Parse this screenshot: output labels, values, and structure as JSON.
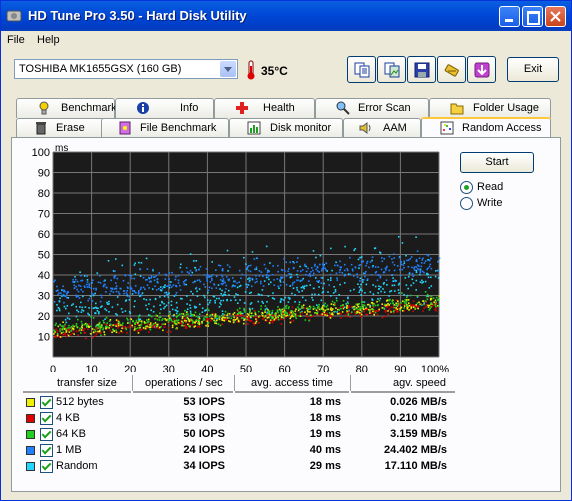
{
  "window": {
    "title": "HD Tune Pro 3.50 - Hard Disk Utility"
  },
  "menu": {
    "file": "File",
    "help": "Help"
  },
  "toolbar": {
    "drive": "TOSHIBA MK1655GSX (160 GB)",
    "temperature": "35°C",
    "exit_label": "Exit",
    "icons": [
      "copy-text-icon",
      "copy-image-icon",
      "save-icon",
      "options-icon",
      "download-icon"
    ]
  },
  "tabs_top": [
    {
      "label": "Benchmark",
      "icon": "benchmark-icon"
    },
    {
      "label": "Info",
      "icon": "info-icon"
    },
    {
      "label": "Health",
      "icon": "health-icon"
    },
    {
      "label": "Error Scan",
      "icon": "error-scan-icon"
    },
    {
      "label": "Folder Usage",
      "icon": "folder-icon"
    }
  ],
  "tabs_bottom": [
    {
      "label": "Erase",
      "icon": "erase-icon"
    },
    {
      "label": "File Benchmark",
      "icon": "file-benchmark-icon"
    },
    {
      "label": "Disk monitor",
      "icon": "disk-monitor-icon"
    },
    {
      "label": "AAM",
      "icon": "speaker-icon"
    },
    {
      "label": "Random Access",
      "icon": "random-access-icon",
      "active": true
    }
  ],
  "controls": {
    "start_label": "Start",
    "read_label": "Read",
    "write_label": "Write",
    "selected": "Read"
  },
  "chart_data": {
    "type": "scatter",
    "ylabel": "ms",
    "ylim": [
      0,
      100
    ],
    "xlim": [
      0,
      100
    ],
    "y_ticks": [
      "100",
      "90",
      "80",
      "70",
      "60",
      "50",
      "40",
      "30",
      "20",
      "10"
    ],
    "x_ticks": [
      "0",
      "10",
      "20",
      "30",
      "40",
      "50",
      "60",
      "70",
      "80",
      "90",
      "100%"
    ],
    "grid": true,
    "background": "#1b1b1b",
    "series": [
      {
        "name": "512 bytes",
        "color": "#f0f000",
        "trend_start_ms": 13,
        "trend_end_ms": 27,
        "spread_ms": 5
      },
      {
        "name": "4 KB",
        "color": "#e00000",
        "trend_start_ms": 12,
        "trend_end_ms": 26,
        "spread_ms": 5
      },
      {
        "name": "64 KB",
        "color": "#20d020",
        "trend_start_ms": 14,
        "trend_end_ms": 28,
        "spread_ms": 6
      },
      {
        "name": "1 MB",
        "color": "#2080ff",
        "trend_start_ms": 33,
        "trend_end_ms": 46,
        "spread_ms": 10
      },
      {
        "name": "Random",
        "color": "#20d8ff",
        "trend_start_ms": 22,
        "trend_end_ms": 36,
        "spread_ms": 14
      }
    ]
  },
  "results": {
    "headers": [
      "transfer size",
      "operations / sec",
      "avg. access time",
      "agv. speed"
    ],
    "rows": [
      {
        "size": "512 bytes",
        "color": "#f0f000",
        "ops": "53 IOPS",
        "access": "18 ms",
        "speed": "0.026 MB/s"
      },
      {
        "size": "4 KB",
        "color": "#e00000",
        "ops": "53 IOPS",
        "access": "18 ms",
        "speed": "0.210 MB/s"
      },
      {
        "size": "64 KB",
        "color": "#20d020",
        "ops": "50 IOPS",
        "access": "19 ms",
        "speed": "3.159 MB/s"
      },
      {
        "size": "1 MB",
        "color": "#2080ff",
        "ops": "24 IOPS",
        "access": "40 ms",
        "speed": "24.402 MB/s"
      },
      {
        "size": "Random",
        "color": "#20d8ff",
        "ops": "34 IOPS",
        "access": "29 ms",
        "speed": "17.110 MB/s"
      }
    ]
  }
}
